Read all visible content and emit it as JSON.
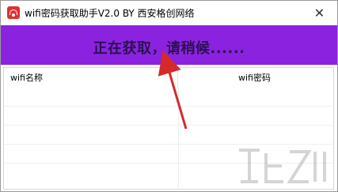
{
  "window": {
    "title": "wifi密码获取助手V2.0 BY 西安格创网络",
    "close_glyph": "✕"
  },
  "banner": {
    "text": "正在获取，请稍候......",
    "color": "#8b22e0"
  },
  "list": {
    "columns": [
      "wifi名称",
      "wifi密码"
    ]
  },
  "colors": {
    "accent": "#8b22e0",
    "arrow": "#d42a2a"
  }
}
